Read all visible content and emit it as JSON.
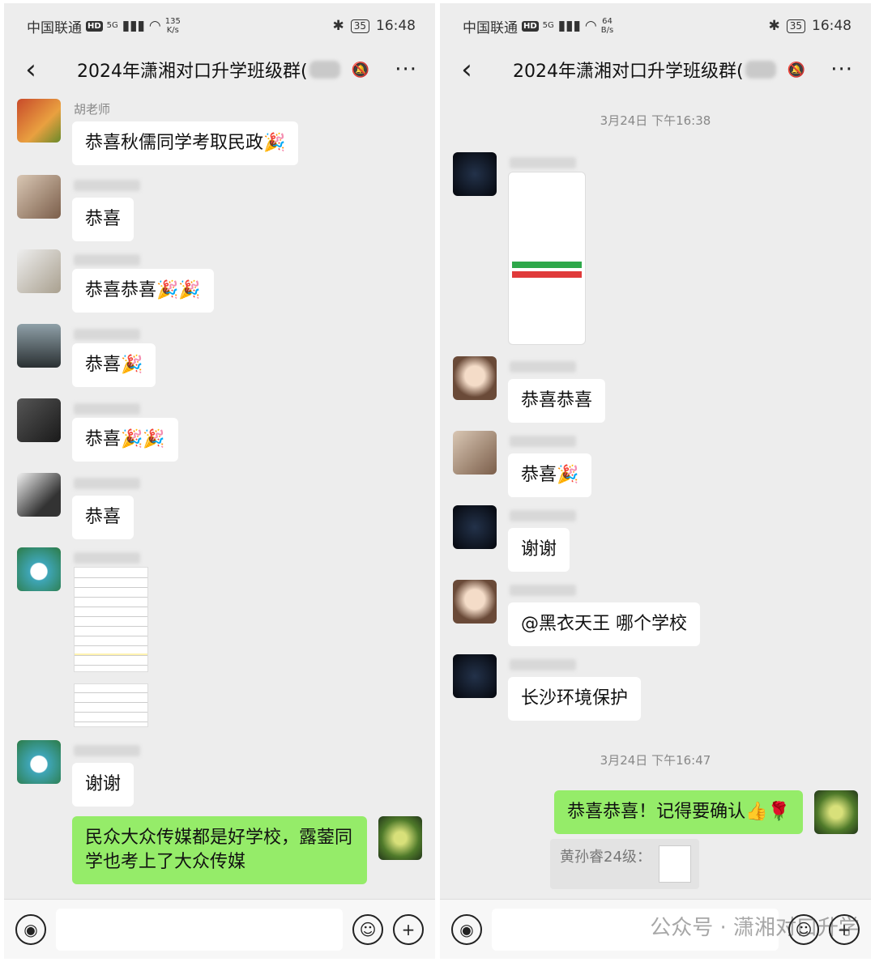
{
  "status": {
    "carrier": "中国联通",
    "hd": "HD",
    "net": "5G",
    "speed_left": "135\nK/s",
    "speed_right": "64\nB/s",
    "battery": "35",
    "time": "16:48"
  },
  "header": {
    "back": "‹",
    "title": "2024年潇湘对口升学班级群(",
    "more": "···"
  },
  "left_chat": {
    "teacher_name": "胡老师",
    "m1": "恭喜秋儒同学考取民政",
    "m2": "恭喜",
    "m3": "恭喜恭喜",
    "m4": "恭喜",
    "m5": "恭喜",
    "m6": "恭喜",
    "m7": "谢谢",
    "m8": "民众大众传媒都是好学校，露蓥同学也考上了大众传媒"
  },
  "right_chat": {
    "time1": "3月24日 下午16:38",
    "m1": "恭喜恭喜",
    "m2": "恭喜",
    "m3": "谢谢",
    "m4": "@黑衣天王  哪个学校",
    "m5": "长沙环境保护",
    "time2": "3月24日 下午16:47",
    "m6": "恭喜恭喜！记得要确认",
    "reply": "黄孙睿24级："
  },
  "watermark": "公众号 · 潇湘对口升学",
  "colors": {
    "bg": "#ededed",
    "mine": "#95ec69",
    "bubble": "#ffffff"
  }
}
